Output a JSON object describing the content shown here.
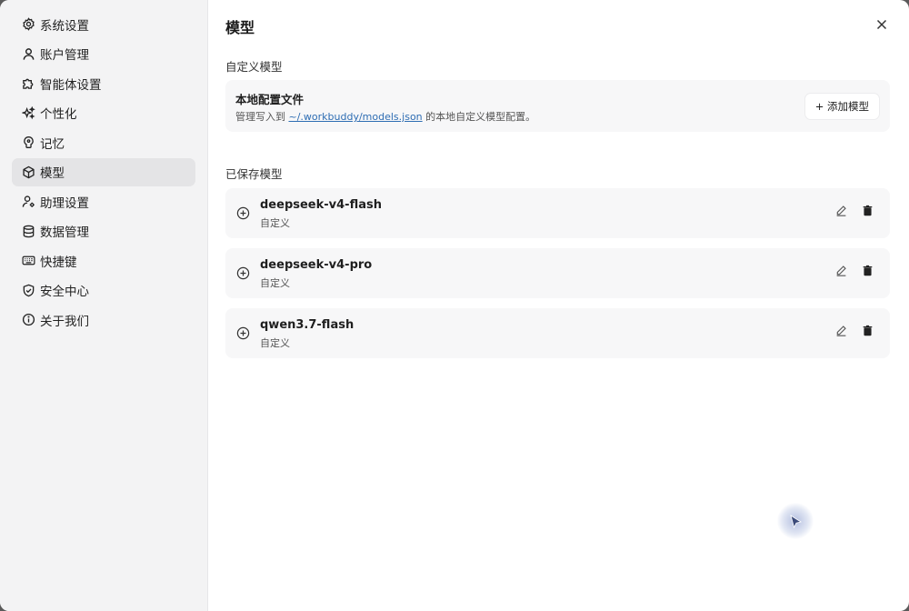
{
  "sidebar": {
    "items": [
      {
        "label": "系统设置",
        "icon": "gear-icon"
      },
      {
        "label": "账户管理",
        "icon": "user-icon"
      },
      {
        "label": "智能体设置",
        "icon": "puzzle-icon"
      },
      {
        "label": "个性化",
        "icon": "sparkle-icon"
      },
      {
        "label": "记忆",
        "icon": "brain-icon"
      },
      {
        "label": "模型",
        "icon": "cube-icon",
        "active": true
      },
      {
        "label": "助理设置",
        "icon": "user-gear-icon"
      },
      {
        "label": "数据管理",
        "icon": "database-icon"
      },
      {
        "label": "快捷键",
        "icon": "keyboard-icon"
      },
      {
        "label": "安全中心",
        "icon": "shield-icon"
      },
      {
        "label": "关于我们",
        "icon": "info-icon"
      }
    ]
  },
  "header": {
    "title": "模型",
    "close_icon": "close-icon"
  },
  "custom": {
    "section_label": "自定义模型",
    "card_title": "本地配置文件",
    "desc_prefix": "管理写入到 ",
    "desc_link": "~/.workbuddy/models.json",
    "desc_suffix": " 的本地自定义模型配置。",
    "add_button": "+ 添加模型"
  },
  "saved": {
    "section_label": "已保存模型",
    "models": [
      {
        "name": "deepseek-v4-flash",
        "type": "自定义"
      },
      {
        "name": "deepseek-v4-pro",
        "type": "自定义"
      },
      {
        "name": "qwen3.7-flash",
        "type": "自定义"
      }
    ]
  },
  "colors": {
    "sidebar_bg": "#f3f3f4",
    "active_bg": "#e4e4e6",
    "card_bg": "#f7f7f8",
    "link": "#2e6db3"
  }
}
